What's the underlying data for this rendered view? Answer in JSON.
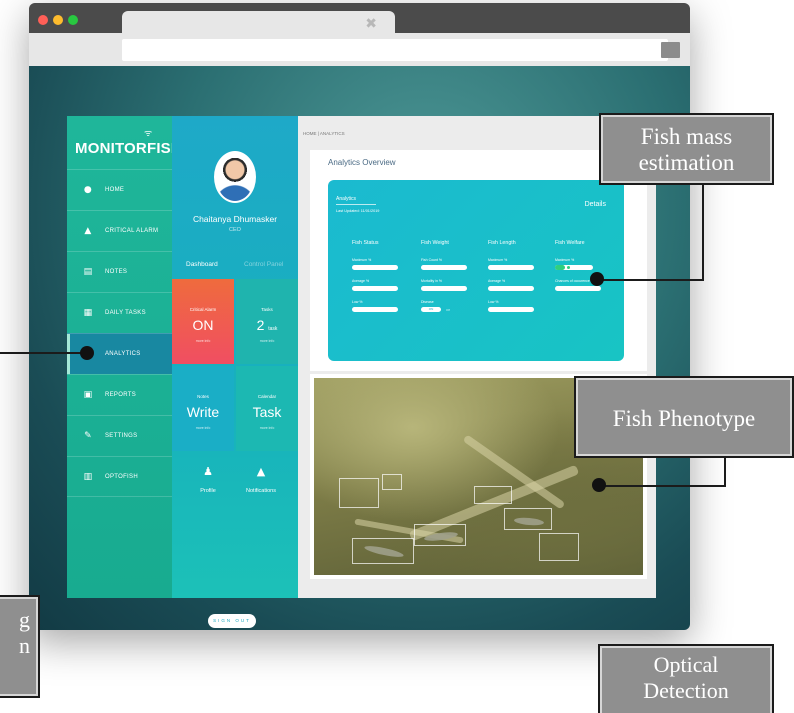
{
  "app": {
    "logo": "MONITORFISH",
    "nav": [
      {
        "label": "HOME",
        "icon": "globe-icon"
      },
      {
        "label": "CRITICAL ALARM",
        "icon": "bell-icon"
      },
      {
        "label": "NOTES",
        "icon": "note-icon"
      },
      {
        "label": "DAILY TASKS",
        "icon": "tasks-icon"
      },
      {
        "label": "ANALYTICS",
        "icon": "chart-icon",
        "active": true
      },
      {
        "label": "REPORTS",
        "icon": "report-icon"
      },
      {
        "label": "SETTINGS",
        "icon": "wrench-icon"
      },
      {
        "label": "OPTOFISH",
        "icon": "grid-icon"
      }
    ]
  },
  "profile": {
    "name": "Chaitanya Dhumasker",
    "role": "CEO",
    "tab_dashboard": "Dashboard",
    "tab_control": "Control Panel",
    "tiles": {
      "alarm": {
        "label": "Critical Alarm",
        "value": "ON",
        "more": "more info"
      },
      "tasks": {
        "label": "Tasks",
        "value": "2",
        "unit": "task",
        "more": "more info"
      },
      "notes": {
        "label": "Notes",
        "value": "Write",
        "more": "more info"
      },
      "calendar": {
        "label": "Calendar",
        "value": "Task",
        "more": "more info"
      }
    },
    "profile_label": "Profile",
    "notifications_label": "Notifications",
    "signout": "SIGN OUT"
  },
  "main": {
    "breadcrumb": "HOME  |  ANALYTICS",
    "panel_title": "Analytics Overview",
    "card": {
      "title": "Analytics",
      "updated": "Last Updated: 11/01/2019",
      "details": "Details",
      "columns": [
        {
          "header": "Fish Status",
          "metrics": [
            "Maximum %",
            "Average %",
            "Low %"
          ]
        },
        {
          "header": "Fish Weight",
          "metrics": [
            "Fish Count %",
            "Mortality in %",
            "Disease"
          ]
        },
        {
          "header": "Fish Length",
          "metrics": [
            "Maximum %",
            "Average %",
            "Low %"
          ]
        },
        {
          "header": "Fish Welfare",
          "metrics": [
            "Maximum %",
            "Chances of occurence %"
          ]
        }
      ],
      "toggle_on": "ON",
      "toggle_off": "Off"
    }
  },
  "callouts": {
    "mass": "Fish mass estimation",
    "phenotype": "Fish Phenotype",
    "left_partial_1": "g",
    "left_partial_2": "n",
    "optical_1": "Optical",
    "optical_2": "Detection"
  }
}
